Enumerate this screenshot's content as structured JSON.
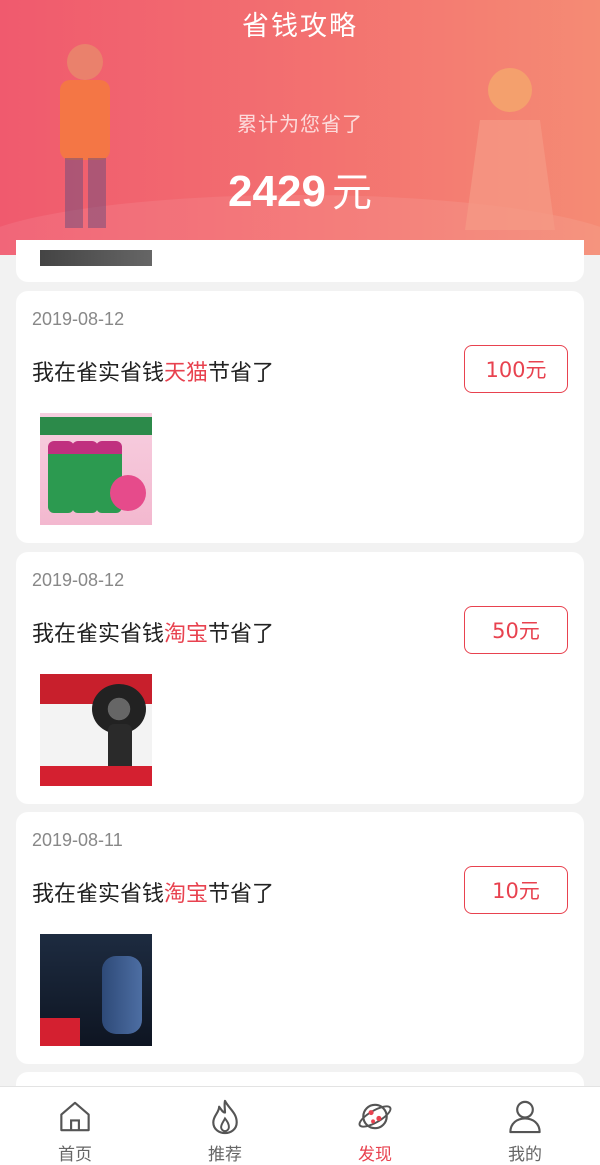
{
  "header": {
    "title": "省钱攻略",
    "subtitle": "累计为您省了",
    "total_amount": "2429",
    "total_unit": "元"
  },
  "records": [
    {
      "date": "2019-08-12",
      "prefix": "我在雀实省钱",
      "platform": "天猫",
      "suffix": "节省了",
      "amount": "100元",
      "product_icon": "detergent-product-image"
    },
    {
      "date": "2019-08-12",
      "prefix": "我在雀实省钱",
      "platform": "淘宝",
      "suffix": "节省了",
      "amount": "50元",
      "product_icon": "shaver-product-image"
    },
    {
      "date": "2019-08-11",
      "prefix": "我在雀实省钱",
      "platform": "淘宝",
      "suffix": "节省了",
      "amount": "10元",
      "product_icon": "shaver-product-image"
    }
  ],
  "tabbar": {
    "items": [
      {
        "label": "首页",
        "icon": "home-icon"
      },
      {
        "label": "推荐",
        "icon": "flame-icon"
      },
      {
        "label": "发现",
        "icon": "planet-icon"
      },
      {
        "label": "我的",
        "icon": "user-icon"
      }
    ],
    "active_index": 2
  },
  "colors": {
    "accent": "#e8424f",
    "header_start": "#f05a6e",
    "header_end": "#f58b74"
  }
}
